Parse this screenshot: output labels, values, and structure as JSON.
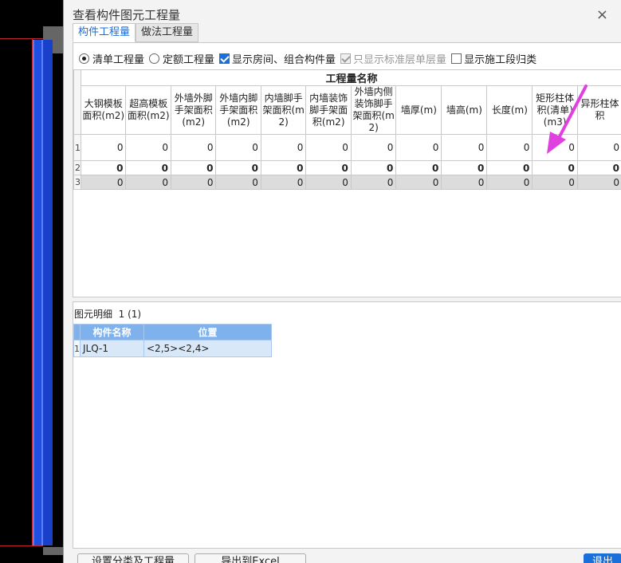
{
  "window": {
    "title": "查看构件图元工程量",
    "close_glyph": "×"
  },
  "tabs": [
    {
      "label": "构件工程量",
      "active": true
    },
    {
      "label": "做法工程量",
      "active": false
    }
  ],
  "options": {
    "radio_list": "清单工程量",
    "radio_quota": "定额工程量",
    "chk_show_rooms": "显示房间、组合构件量",
    "chk_standard_floor": "只显示标准层单层量",
    "chk_construction_segment": "显示施工段归类"
  },
  "quantities": {
    "group_header": "工程量名称",
    "columns": [
      "大钢模板面积(m2)",
      "超高模板面积(m2)",
      "外墙外脚手架面积(m2)",
      "外墙内脚手架面积(m2)",
      "内墙脚手架面积(m2)",
      "内墙装饰脚手架面积(m2)",
      "外墙内侧装饰脚手架面积(m2)",
      "墙厚(m)",
      "墙高(m)",
      "长度(m)",
      "矩形柱体积(清单)(m3)",
      "异形柱体积"
    ],
    "rows": [
      {
        "num": "1",
        "values": [
          "0",
          "0",
          "0",
          "0",
          "0",
          "0",
          "0",
          "0",
          "0",
          "0",
          "0",
          "0"
        ]
      },
      {
        "num": "2",
        "values": [
          "0",
          "0",
          "0",
          "0",
          "0",
          "0",
          "0",
          "0",
          "0",
          "0",
          "0",
          "0"
        ]
      },
      {
        "num": "3",
        "values": [
          "0",
          "0",
          "0",
          "0",
          "0",
          "0",
          "0",
          "0",
          "0",
          "0",
          "0",
          "0"
        ]
      }
    ]
  },
  "detail": {
    "title": "图元明细",
    "count": "1 (1)",
    "headers": [
      "构件名称",
      "位置"
    ],
    "rows": [
      {
        "num": "1",
        "name": "JLQ-1",
        "position": "<2,5><2,4>"
      }
    ]
  },
  "buttons": {
    "set_classification": "设置分类及工程量",
    "export_excel": "导出到Excel",
    "exit": "退出"
  },
  "colors": {
    "accent": "#1a6fd8",
    "arrow": "#e040e0",
    "detail_header": "#7fb2ec"
  }
}
